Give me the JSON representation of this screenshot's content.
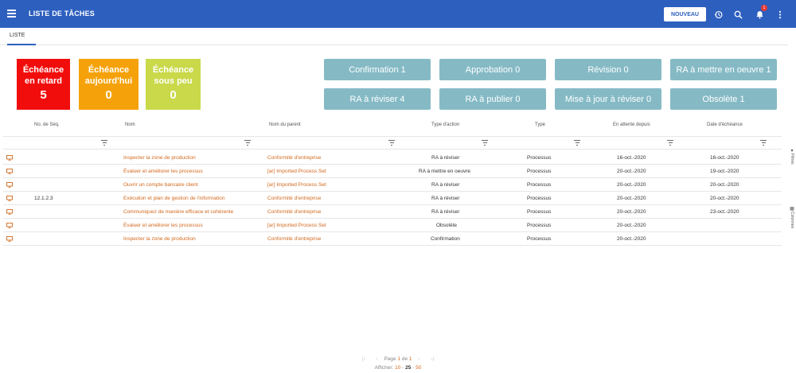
{
  "app": {
    "title": "LISTE DE TÂCHES",
    "new_button": "NOUVEAU",
    "notification_count": "1"
  },
  "tabs": [
    {
      "label": "LISTE"
    }
  ],
  "tiles": [
    {
      "label_1": "Échéance",
      "label_2": "en retard",
      "count": "5",
      "color": "#f20d0d"
    },
    {
      "label_1": "Échéance",
      "label_2": "aujourd'hui",
      "count": "0",
      "color": "#f5a20a"
    },
    {
      "label_1": "Échéance",
      "label_2": "sous peu",
      "count": "0",
      "color": "#c9d94a"
    }
  ],
  "stat_buttons": [
    "Confirmation 1",
    "Approbation 0",
    "Révision 0",
    "RA à mettre en oeuvre 1",
    "RA à réviser 4",
    "RA à publier 0",
    "Mise à jour à réviser 0",
    "Obsolète 1"
  ],
  "columns": [
    "No. de Séq.",
    "Nom",
    "Nom du parent",
    "Type d'action",
    "Type",
    "En attente depuis",
    "Date d'échéance"
  ],
  "rows": [
    {
      "seq": "",
      "name": "Inspecter la zone de production",
      "parent": "Conformité d'entreprise",
      "action": "RA à réviser",
      "type": "Processus",
      "since": "16-oct.-2020",
      "due": "16-oct.-2020"
    },
    {
      "seq": "",
      "name": "Évaluer et améliorer les processus",
      "parent": "[ar] Imported Process Set",
      "action": "RA à mettre en oeuvre",
      "type": "Processus",
      "since": "20-oct.-2020",
      "due": "19-oct.-2020"
    },
    {
      "seq": "",
      "name": "Ouvrir un compte bancaire client",
      "parent": "[ar] Imported Process Set",
      "action": "RA à réviser",
      "type": "Processus",
      "since": "20-oct.-2020",
      "due": "20-oct.-2020"
    },
    {
      "seq": "12.1.2.3",
      "name": "Exécution et plan de gestion de l'information",
      "parent": "Conformité d'entreprise",
      "action": "RA à réviser",
      "type": "Processus",
      "since": "20-oct.-2020",
      "due": "20-oct.-2020"
    },
    {
      "seq": "",
      "name": "Communiquez de manière efficace et cohérente",
      "parent": "Conformité d'entreprise",
      "action": "RA à réviser",
      "type": "Processus",
      "since": "20-oct.-2020",
      "due": "23-oct.-2020"
    },
    {
      "seq": "",
      "name": "Évaluer et améliorer les processus",
      "parent": "[ar] Imported Process Set",
      "action": "Obsolète",
      "type": "Processus",
      "since": "20-oct.-2020",
      "due": ""
    },
    {
      "seq": "",
      "name": "Inspecter la zone de production",
      "parent": "Conformité d'entreprise",
      "action": "Confirmation",
      "type": "Processus",
      "since": "20-oct.-2020",
      "due": ""
    }
  ],
  "side": {
    "filters": "Filtres",
    "columns": "Colonnes"
  },
  "pager": {
    "page_label": "Page",
    "page": "1",
    "of_label": "de",
    "total": "1",
    "show_label": "Afficher:",
    "sizes": [
      "10",
      "25",
      "50"
    ],
    "active_size": "25"
  }
}
